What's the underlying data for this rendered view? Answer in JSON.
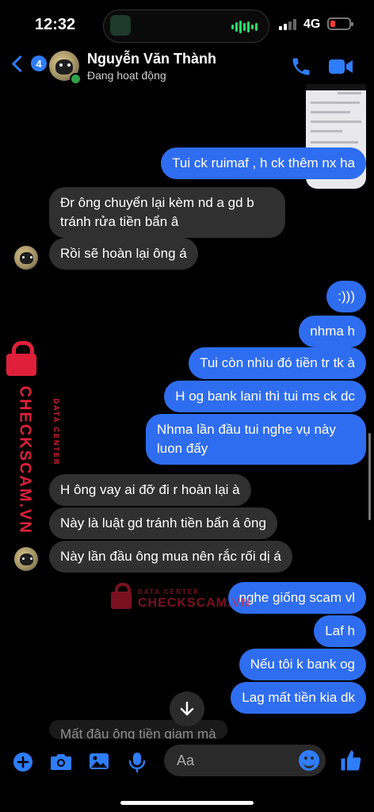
{
  "status_bar": {
    "time": "12:32",
    "network": "4G",
    "battery_level": 0.15
  },
  "header": {
    "unread_count": "4",
    "contact_name": "Nguyễn Văn Thành",
    "contact_status": "Đang hoạt động"
  },
  "messages": [
    {
      "side": "out",
      "text": "Tui ck ruimaf , h ck thêm nx ha"
    },
    {
      "side": "in",
      "text": "Đr ông chuyển lại kèm nd a gd b tránh rửa tiền bẩn â"
    },
    {
      "side": "in",
      "text": "Rồi sẽ hoàn lại ông á"
    },
    {
      "side": "out",
      "text": ":)))"
    },
    {
      "side": "out",
      "text": "nhma h"
    },
    {
      "side": "out",
      "text": "Tui còn nhìu đó tiền tr tk à"
    },
    {
      "side": "out",
      "text": "H og bank lani thì tui ms ck dc"
    },
    {
      "side": "out",
      "text": "Nhma lần đầu tui nghe vụ này luon đấy"
    },
    {
      "side": "in",
      "text": "H ông vay ai đỡ đi r hoàn lại à"
    },
    {
      "side": "in",
      "text": "Này là luật gd tránh tiền bẩn á ông"
    },
    {
      "side": "in",
      "text": "Này lần đầu ông mua nên rắc rối dị á"
    },
    {
      "side": "out",
      "text": "nghe giống scam vl"
    },
    {
      "side": "out",
      "text": "Laf h"
    },
    {
      "side": "out",
      "text": "Nếu tôi k bank og"
    },
    {
      "side": "out",
      "text": "Lag mất tiền kia dk"
    },
    {
      "side": "in",
      "text": "Mất đâu ông tiền giam mà"
    }
  ],
  "watermark": {
    "label_small": "DATA CENTER",
    "label_big": "CHECKSCAM.VN"
  },
  "composer": {
    "placeholder": "Aa"
  },
  "colors": {
    "outgoing_bubble": "#2f6df0",
    "incoming_bubble": "#303030",
    "accent": "#2f7dfb",
    "watermark": "#e0203a"
  }
}
